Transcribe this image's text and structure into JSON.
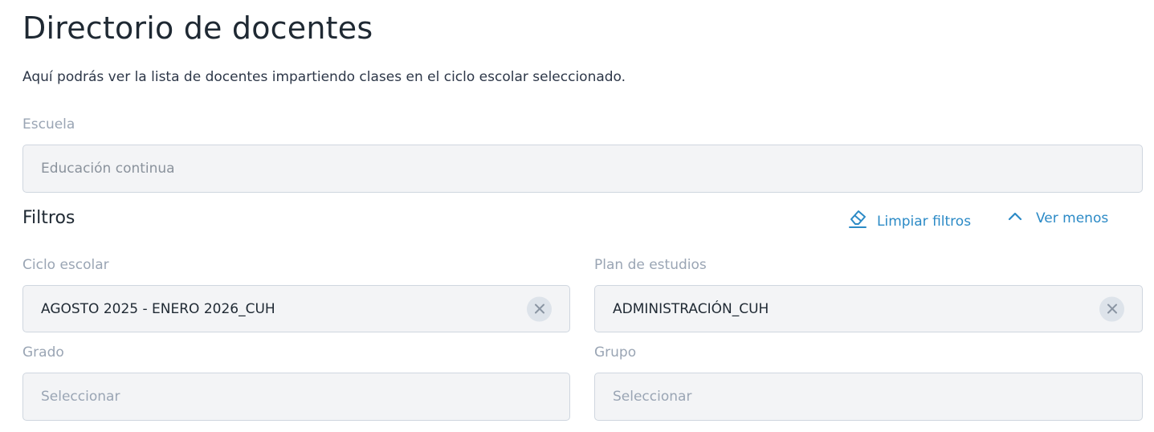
{
  "header": {
    "title": "Directorio de docentes",
    "subtitle": "Aquí podrás ver la lista de docentes impartiendo clases en el ciclo escolar seleccionado."
  },
  "school": {
    "label": "Escuela",
    "value": "Educación continua"
  },
  "filters": {
    "title": "Filtros",
    "clear_label": "Limpiar filtros",
    "toggle_label": "Ver menos",
    "clear_icon": "eraser-icon",
    "toggle_icon": "chevron-up-icon",
    "accent_color": "#2b8ac6",
    "cycle": {
      "label": "Ciclo escolar",
      "value": "AGOSTO 2025 - ENERO 2026_CUH"
    },
    "plan": {
      "label": "Plan de estudios",
      "value": "ADMINISTRACIÓN_CUH"
    },
    "grade": {
      "label": "Grado",
      "placeholder": "Seleccionar"
    },
    "group": {
      "label": "Grupo",
      "placeholder": "Seleccionar"
    }
  }
}
